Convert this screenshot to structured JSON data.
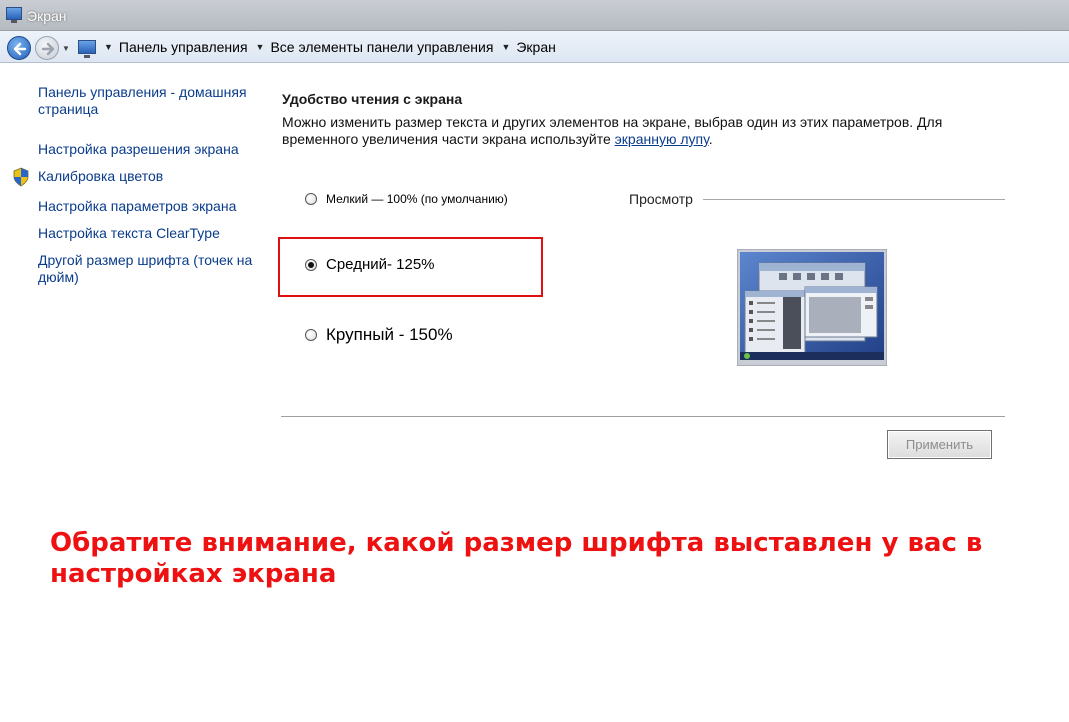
{
  "window": {
    "title": "Экран"
  },
  "address_bar": {
    "crumbs": [
      "Панель управления",
      "Все элементы панели управления",
      "Экран"
    ]
  },
  "left_panel": {
    "links": [
      "Панель управления - домашняя страница",
      "Настройка разрешения экрана",
      "Калибровка цветов",
      "Настройка параметров экрана",
      "Настройка текста ClearType",
      "Другой размер шрифта (точек на дюйм)"
    ]
  },
  "main": {
    "heading": "Удобство чтения с экрана",
    "description_line1": "Можно изменить размер текста и других элементов на экране, выбрав один из этих параметров. Для",
    "description_line2_prefix": "временного увеличения части экрана используйте ",
    "description_link": "экранную лупу",
    "description_suffix": ".",
    "options": [
      {
        "label": "Мелкий — 100% (по умолчанию)",
        "checked": false
      },
      {
        "label": "Средний- 125%",
        "checked": true
      },
      {
        "label": "Крупный - 150%",
        "checked": false
      }
    ],
    "preview_label": "Просмотр",
    "apply_label": "Применить"
  },
  "annotation": {
    "text": "Обратите внимание, какой размер шрифта выставлен у вас в настройках экрана",
    "color": "#ee1111"
  }
}
